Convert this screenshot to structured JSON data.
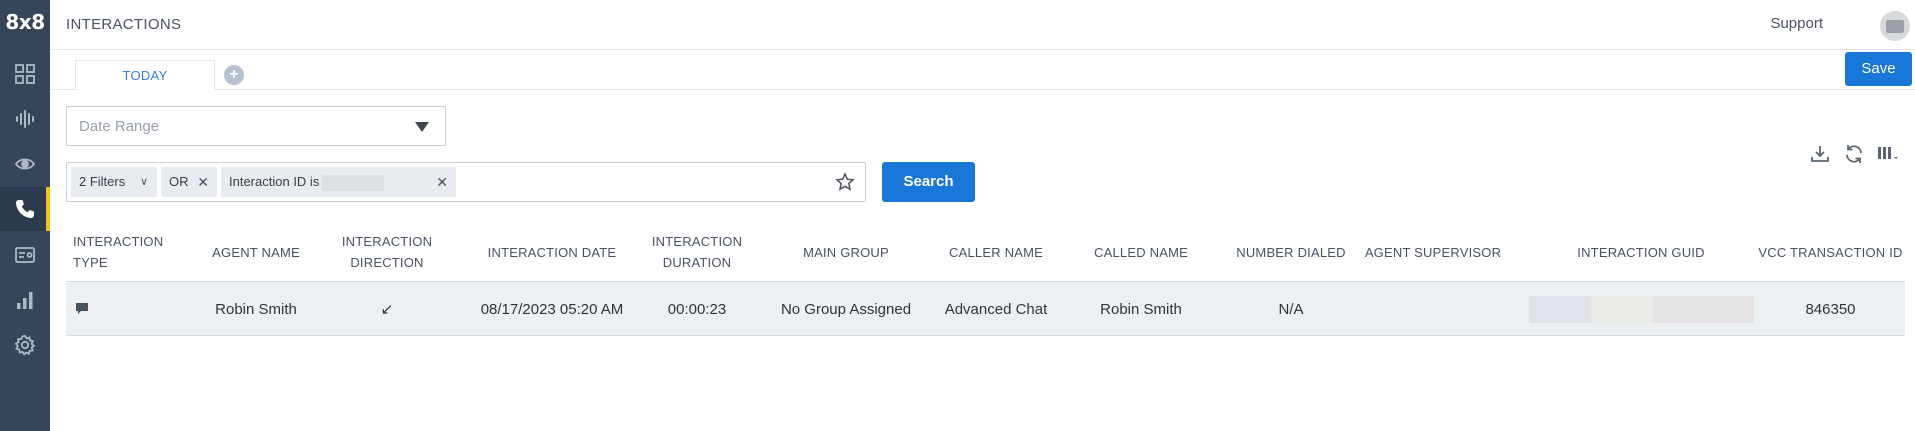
{
  "app": {
    "logo": "8x8",
    "title": "INTERACTIONS",
    "support": "Support"
  },
  "sidebar": {
    "items": [
      {
        "icon": "dashboard-icon"
      },
      {
        "icon": "waveform-icon"
      },
      {
        "icon": "eye-icon"
      },
      {
        "icon": "phone-icon",
        "active": true
      },
      {
        "icon": "id-card-icon"
      },
      {
        "icon": "bar-chart-icon"
      },
      {
        "icon": "gear-icon"
      }
    ],
    "accent": "#f4c21b"
  },
  "tabs": [
    {
      "label": "TODAY"
    }
  ],
  "toolbar": {
    "save_label": "Save",
    "search_label": "Search"
  },
  "date_range": {
    "placeholder": "Date Range"
  },
  "filters": {
    "count_label": "2 Filters",
    "operator": "OR",
    "condition": "Interaction ID is"
  },
  "table": {
    "columns": [
      "INTERACTION TYPE",
      "AGENT NAME",
      "INTERACTION DIRECTION",
      "INTERACTION DATE",
      "INTERACTION DURATION",
      "MAIN GROUP",
      "CALLER NAME",
      "CALLED NAME",
      "NUMBER DIALED",
      "AGENT SUPERVISOR",
      "INTERACTION GUID",
      "VCC TRANSACTION ID"
    ],
    "rows": [
      {
        "type_icon": "chat-icon",
        "agent_name": "Robin Smith",
        "direction": "↙",
        "date": "08/17/2023 05:20 AM",
        "duration": "00:00:23",
        "main_group": "No Group Assigned",
        "caller_name": "Advanced Chat",
        "called_name": "Robin Smith",
        "number_dialed": "N/A",
        "agent_supervisor": "",
        "vcc_transaction_id": "846350"
      }
    ]
  },
  "colors": {
    "primary": "#1977d8",
    "sidebar": "#36455a",
    "row_bg": "#edf0f3"
  }
}
